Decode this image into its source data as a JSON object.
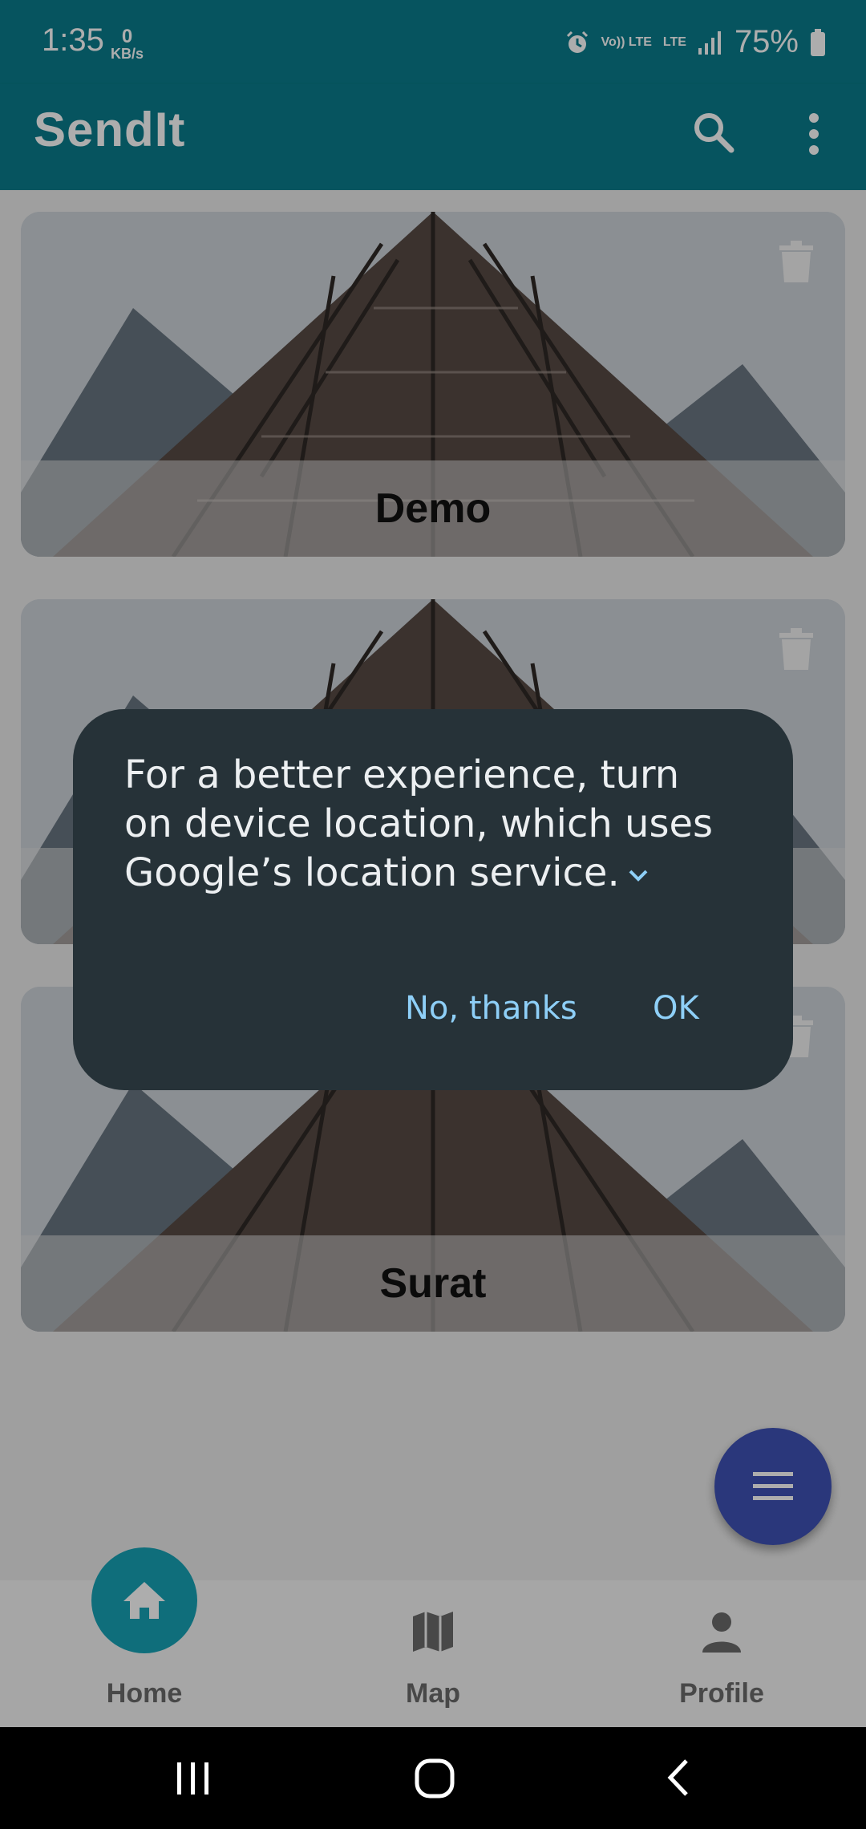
{
  "status_bar": {
    "time": "1:35",
    "net_speed_value": "0",
    "net_speed_unit": "KB/s",
    "volte": "Vo)) LTE",
    "lte": "LTE",
    "battery": "75%"
  },
  "app_bar": {
    "title": "SendIt",
    "search_icon": "search-icon",
    "more_icon": "more-vert-icon"
  },
  "cards": [
    {
      "label": "Demo"
    },
    {
      "label": ""
    },
    {
      "label": "Surat"
    }
  ],
  "fab": {
    "icon": "menu-icon"
  },
  "bottom_nav": {
    "items": [
      {
        "label": "Home",
        "icon": "home-icon"
      },
      {
        "label": "Map",
        "icon": "map-icon"
      },
      {
        "label": "Profile",
        "icon": "person-icon"
      }
    ]
  },
  "dialog": {
    "message": "For a better experience, turn on device location, which uses Google’s location service.",
    "negative_label": "No, thanks",
    "positive_label": "OK"
  },
  "colors": {
    "app_bar": "#097d8c",
    "fab": "#3f51b5",
    "home_active": "#17a3b6",
    "dialog_bg": "#263238",
    "dialog_button": "#8ecff7"
  }
}
